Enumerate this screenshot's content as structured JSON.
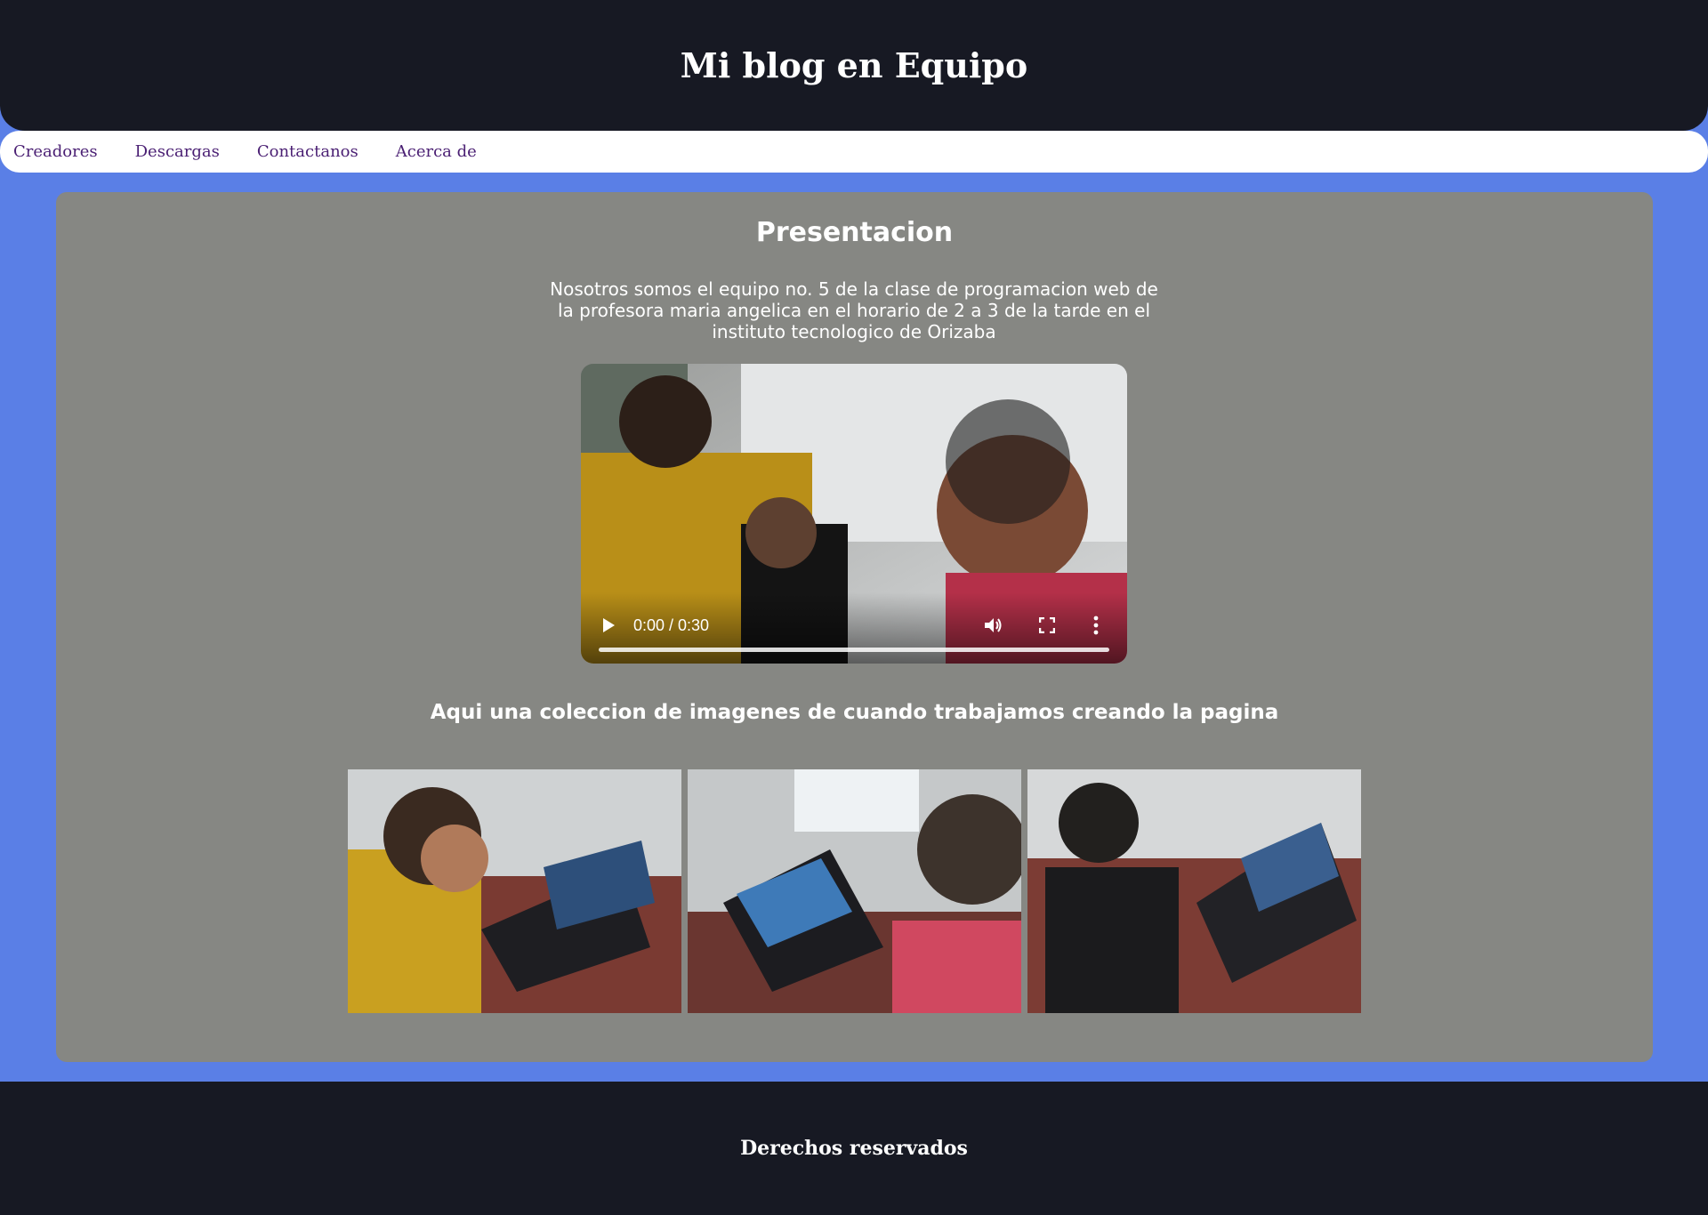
{
  "header": {
    "title": "Mi blog en Equipo"
  },
  "nav": {
    "items": [
      {
        "label": "Creadores"
      },
      {
        "label": "Descargas"
      },
      {
        "label": "Contactanos"
      },
      {
        "label": "Acerca de"
      }
    ]
  },
  "main": {
    "section_title": "Presentacion",
    "intro_text": "Nosotros somos el equipo no. 5 de la clase de programacion web de la profesora maria angelica en el horario de 2 a 3 de la tarde en el instituto tecnologico de Orizaba",
    "video": {
      "time_display": "0:00 / 0:30",
      "controls": [
        "play-icon",
        "volume-icon",
        "fullscreen-icon",
        "more-options-icon"
      ]
    },
    "gallery_title": "Aqui una coleccion de imagenes de cuando trabajamos creando la pagina",
    "gallery_count": 3
  },
  "footer": {
    "text": "Derechos reservados"
  },
  "colors": {
    "page_background": "#5a7fe6",
    "header_background": "#171923",
    "card_background": "#868783",
    "nav_link": "#4a1f73"
  }
}
